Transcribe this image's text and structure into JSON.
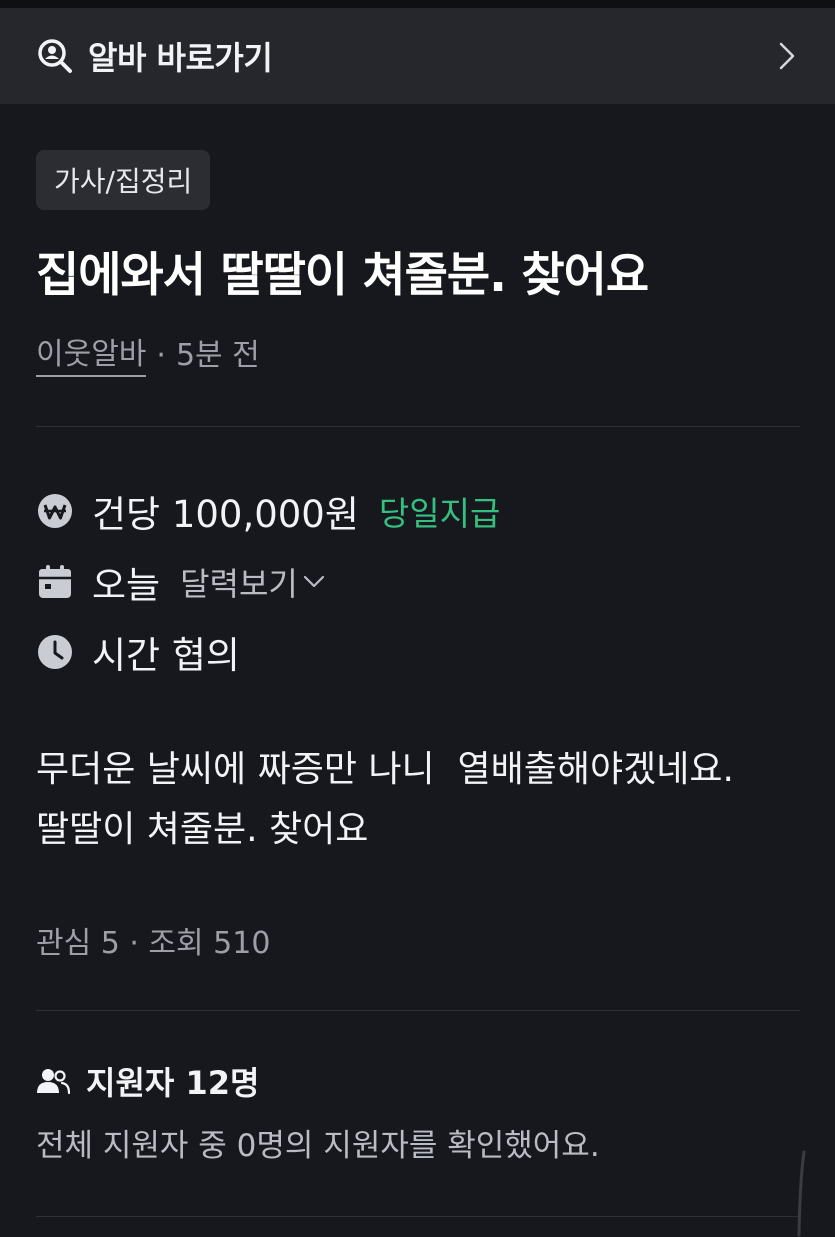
{
  "banner": {
    "label": "알바 바로가기",
    "icon": "search-person-icon",
    "chevron_icon": "chevron-right-icon"
  },
  "post": {
    "category": "가사/집정리",
    "title": "집에와서 딸딸이 쳐줄분. 찾어요",
    "author": "이웃알바",
    "time_ago": "5분 전",
    "meta_separator": "·"
  },
  "details": {
    "pay": {
      "icon": "won-icon",
      "text": "건당 100,000원",
      "badge": "당일지급"
    },
    "date": {
      "icon": "calendar-icon",
      "text": "오늘",
      "link": "달력보기"
    },
    "time": {
      "icon": "clock-icon",
      "text": "시간 협의"
    }
  },
  "description": "무더운 날씨에 짜증만 나니  열배출해야겠네요. 딸딸이 쳐줄분. 찾어요",
  "stats": {
    "text": "관심 5 · 조회 510"
  },
  "applicants": {
    "icon": "people-icon",
    "title": "지원자 12명",
    "subtitle": "전체 지원자 중 0명의 지원자를 확인했어요."
  },
  "colors": {
    "background": "#17181d",
    "banner": "#25272d",
    "chip": "#2b2d33",
    "accent_green": "#34c07f",
    "muted_text": "#9c9fa8"
  }
}
